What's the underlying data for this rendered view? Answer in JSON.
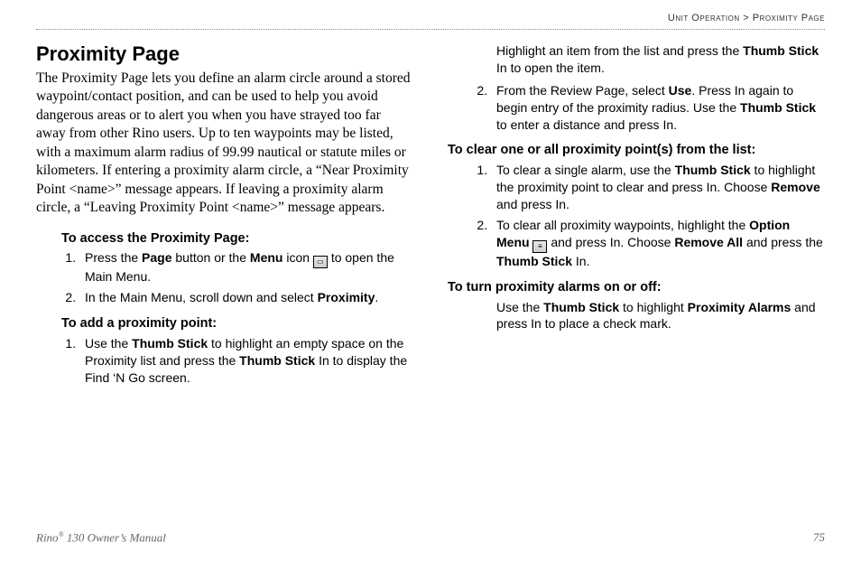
{
  "breadcrumb": {
    "section": "Unit Operation",
    "sep": " > ",
    "page": "Proximity Page"
  },
  "title": "Proximity Page",
  "intro": "The Proximity Page lets you define an alarm circle around a stored waypoint/contact position, and can be used to help you avoid dangerous areas or to alert you when you have strayed too far away from other Rino users. Up to ten waypoints may be listed, with a maximum alarm radius of 99.99 nautical or statute miles or kilometers. If entering a proximity alarm circle, a “Near Proximity Point <name>” message appears. If leaving a proximity alarm circle, a “Leaving Proximity Point <name>” message appears.",
  "sections": {
    "access": {
      "heading": "To access the Proximity Page:",
      "step1_a": "Press the ",
      "step1_b": "Page",
      "step1_c": " button or the ",
      "step1_d": "Menu",
      "step1_e": " icon ",
      "step1_f": " to open the Main Menu.",
      "step2_a": "In the Main Menu, scroll down and select ",
      "step2_b": "Proximity",
      "step2_c": "."
    },
    "add": {
      "heading": "To add a proximity point:",
      "step1_a": "Use the ",
      "step1_b": "Thumb Stick",
      "step1_c": " to highlight an empty space on the Proximity list and press the ",
      "step1_d": "Thumb Stick",
      "step1_e": " In to display the Find ‘N Go screen.",
      "cont_a": "Highlight an item from the list and press the ",
      "cont_b": "Thumb Stick",
      "cont_c": " In to open the item.",
      "step2_a": "From the Review Page, select ",
      "step2_b": "Use",
      "step2_c": ". Press In again to begin entry of the proximity radius. Use the ",
      "step2_d": "Thumb Stick",
      "step2_e": " to enter a distance and press In."
    },
    "clear": {
      "heading": "To clear one or all proximity point(s) from the list:",
      "step1_a": "To clear a single alarm, use the ",
      "step1_b": "Thumb Stick",
      "step1_c": " to highlight the proximity point to clear and press In. Choose ",
      "step1_d": "Remove",
      "step1_e": " and press In.",
      "step2_a": "To clear all proximity waypoints, highlight the ",
      "step2_b": "Option Menu",
      "step2_c": " ",
      "step2_d": " and press In. Choose ",
      "step2_e": "Remove All",
      "step2_f": " and press the ",
      "step2_g": "Thumb Stick",
      "step2_h": " In."
    },
    "toggle": {
      "heading": "To turn proximity alarms on or off:",
      "body_a": "Use the ",
      "body_b": "Thumb Stick",
      "body_c": " to highlight ",
      "body_d": "Proximity Alarms",
      "body_e": " and press In to place a check mark."
    }
  },
  "footer": {
    "left_a": "Rino",
    "left_b": " 130 Owner’s Manual",
    "right": "75"
  }
}
